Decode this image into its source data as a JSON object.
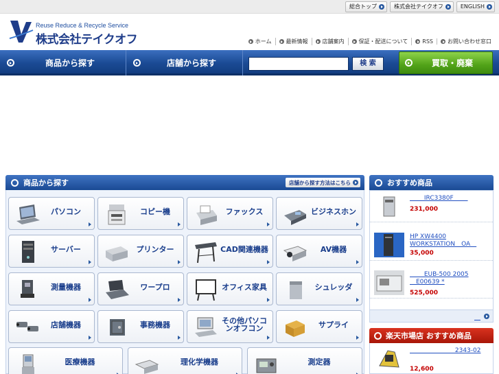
{
  "top_links": [
    {
      "label": "総合トップ"
    },
    {
      "label": "株式会社テイクオフ"
    },
    {
      "label": "ENGLISH"
    }
  ],
  "logo": {
    "tagline": "Reuse Reduce & Recycle Service",
    "name": "株式会社テイクオフ"
  },
  "sub_nav": [
    {
      "label": "ホーム"
    },
    {
      "label": "最新情報"
    },
    {
      "label": "店舗案内"
    },
    {
      "label": "保証・配送について"
    },
    {
      "label": "RSS"
    },
    {
      "label": "お問い合わせ窓口"
    }
  ],
  "nav": {
    "products_label": "商品から探す",
    "stores_label": "店舗から探す",
    "search_placeholder": "",
    "search_button": "検 索",
    "buy_label": "買取・廃棄"
  },
  "categories": {
    "title": "商品から探す",
    "howto_label": "店舗から探す方法はこちら",
    "tiles": [
      {
        "label": "パソコン",
        "icon": "laptop-icon"
      },
      {
        "label": "コピー機",
        "icon": "copier-icon"
      },
      {
        "label": "ファックス",
        "icon": "fax-icon"
      },
      {
        "label": "ビジネスホン",
        "icon": "business-phone-icon"
      },
      {
        "label": "サーバー",
        "icon": "server-icon"
      },
      {
        "label": "プリンター",
        "icon": "printer-icon"
      },
      {
        "label": "CAD関連機器",
        "icon": "plotter-icon"
      },
      {
        "label": "AV機器",
        "icon": "projector-icon"
      },
      {
        "label": "測量機器",
        "icon": "surveying-instrument-icon"
      },
      {
        "label": "ワープロ",
        "icon": "word-processor-icon"
      },
      {
        "label": "オフィス家具",
        "icon": "whiteboard-icon"
      },
      {
        "label": "シュレッダ",
        "icon": "shredder-icon"
      },
      {
        "label": "店舗機器",
        "icon": "security-camera-icon"
      },
      {
        "label": "事務機器",
        "icon": "safe-icon"
      },
      {
        "label": "その他パソコンオフコン",
        "icon": "desktop-pc-icon"
      },
      {
        "label": "サプライ",
        "icon": "supplies-box-icon"
      },
      {
        "label": "医療機器",
        "icon": "medical-device-icon"
      },
      {
        "label": "理化学機器",
        "icon": "lab-equipment-icon"
      },
      {
        "label": "測定器",
        "icon": "measuring-instrument-icon"
      }
    ]
  },
  "recommended": {
    "title": "おすすめ商品",
    "items": [
      {
        "name": "　　 IRC3380F 　　",
        "price": "231,000"
      },
      {
        "name": "HP XW4400 WORKSTATION　OA　",
        "price": "35,000"
      },
      {
        "name": "　　 EUB-500 2005 　E00639 *",
        "price": "525,000"
      }
    ],
    "more_label": "　"
  },
  "rakuten": {
    "title": "楽天市場店 おすすめ商品",
    "items": [
      {
        "name": "　　　　　　　 2343-02",
        "price": "12,600"
      }
    ]
  },
  "colors": {
    "nav_blue": "#1b4b95",
    "green": "#52a319",
    "red": "#c40000",
    "link": "#1f4ec0"
  }
}
